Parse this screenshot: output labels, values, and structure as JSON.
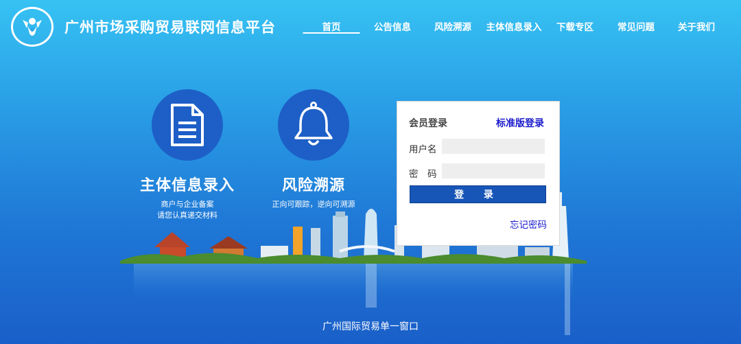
{
  "header": {
    "title": "广州市场采购贸易联网信息平台",
    "logo_icon": "crest-logo-icon"
  },
  "nav": [
    {
      "label": "首页",
      "active": true
    },
    {
      "label": "公告信息"
    },
    {
      "label": "风险溯源"
    },
    {
      "label": "主体信息录入"
    },
    {
      "label": "下载专区"
    },
    {
      "label": "常见问题"
    },
    {
      "label": "关于我们"
    }
  ],
  "features": [
    {
      "icon": "document-icon",
      "title": "主体信息录入",
      "desc_line1": "商户与企业备案",
      "desc_line2": "请您认真递交材料"
    },
    {
      "icon": "bell-icon",
      "title": "风险溯源",
      "desc_line1": "正向可跟踪，逆向可溯源"
    }
  ],
  "login": {
    "heading": "会员登录",
    "standard_login": "标准版登录",
    "username_label": "用户名",
    "username_value": "",
    "password_label": "密　码",
    "password_value": "",
    "submit_label": "登 录",
    "forgot": "忘记密码"
  },
  "footer": {
    "text": "广州国际贸易单一窗口"
  },
  "colors": {
    "bg_top": "#36c2f3",
    "bg_bottom": "#1a5fc9",
    "icon_circle": "#1d5fc7",
    "login_button": "#1755b7",
    "link": "#1a1acc"
  }
}
